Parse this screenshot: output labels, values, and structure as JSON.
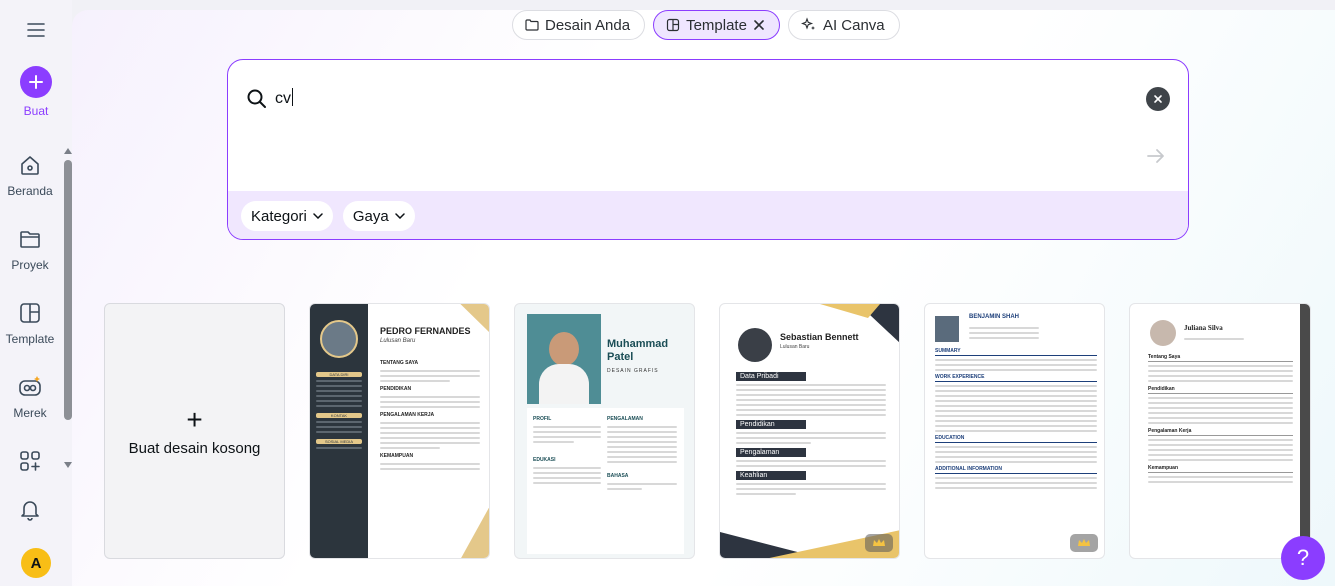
{
  "sidebar": {
    "create_label": "Buat",
    "items": [
      {
        "label": "Beranda",
        "icon": "home-icon"
      },
      {
        "label": "Proyek",
        "icon": "folder-icon"
      },
      {
        "label": "Template",
        "icon": "template-icon"
      },
      {
        "label": "Merek",
        "icon": "brand-icon"
      }
    ],
    "avatar_initial": "A"
  },
  "tabs": [
    {
      "label": "Desain Anda",
      "icon": "folder-icon"
    },
    {
      "label": "Template",
      "icon": "template-icon",
      "active": true
    },
    {
      "label": "AI Canva",
      "icon": "sparkle-icon"
    }
  ],
  "search": {
    "value": "cv",
    "filters": [
      "Kategori",
      "Gaya"
    ]
  },
  "grid": {
    "blank_label": "Buat desain kosong",
    "cards": [
      {
        "name": "PEDRO FERNANDES",
        "subtitle": "Lulusan Baru",
        "sections": [
          "TENTANG SAYA",
          "PENDIDIKAN",
          "PENGALAMAN KERJA",
          "KEMAMPUAN",
          "DATA DIRI",
          "KONTAK",
          "SOSIAL MEDIA"
        ]
      },
      {
        "name_line1": "Muhammad",
        "name_line2": "Patel",
        "subtitle": "DESAIN GRAFIS",
        "sections": [
          "PROFIL",
          "PENGALAMAN",
          "EDUKASI",
          "BAHASA"
        ]
      },
      {
        "name": "Sebastian Bennett",
        "subtitle": "Lulusan Baru",
        "sections": [
          "Data Pribadi",
          "Pendidikan",
          "Pengalaman",
          "Keahlian"
        ]
      },
      {
        "name": "BENJAMIN SHAH",
        "sections": [
          "SUMMARY",
          "WORK EXPERIENCE",
          "EDUCATION",
          "ADDITIONAL INFORMATION"
        ]
      },
      {
        "name": "Juliana Silva",
        "sections": [
          "Tentang Saya",
          "Pendidikan",
          "Pengalaman Kerja",
          "Kemampuan"
        ]
      }
    ]
  },
  "help_label": "?"
}
